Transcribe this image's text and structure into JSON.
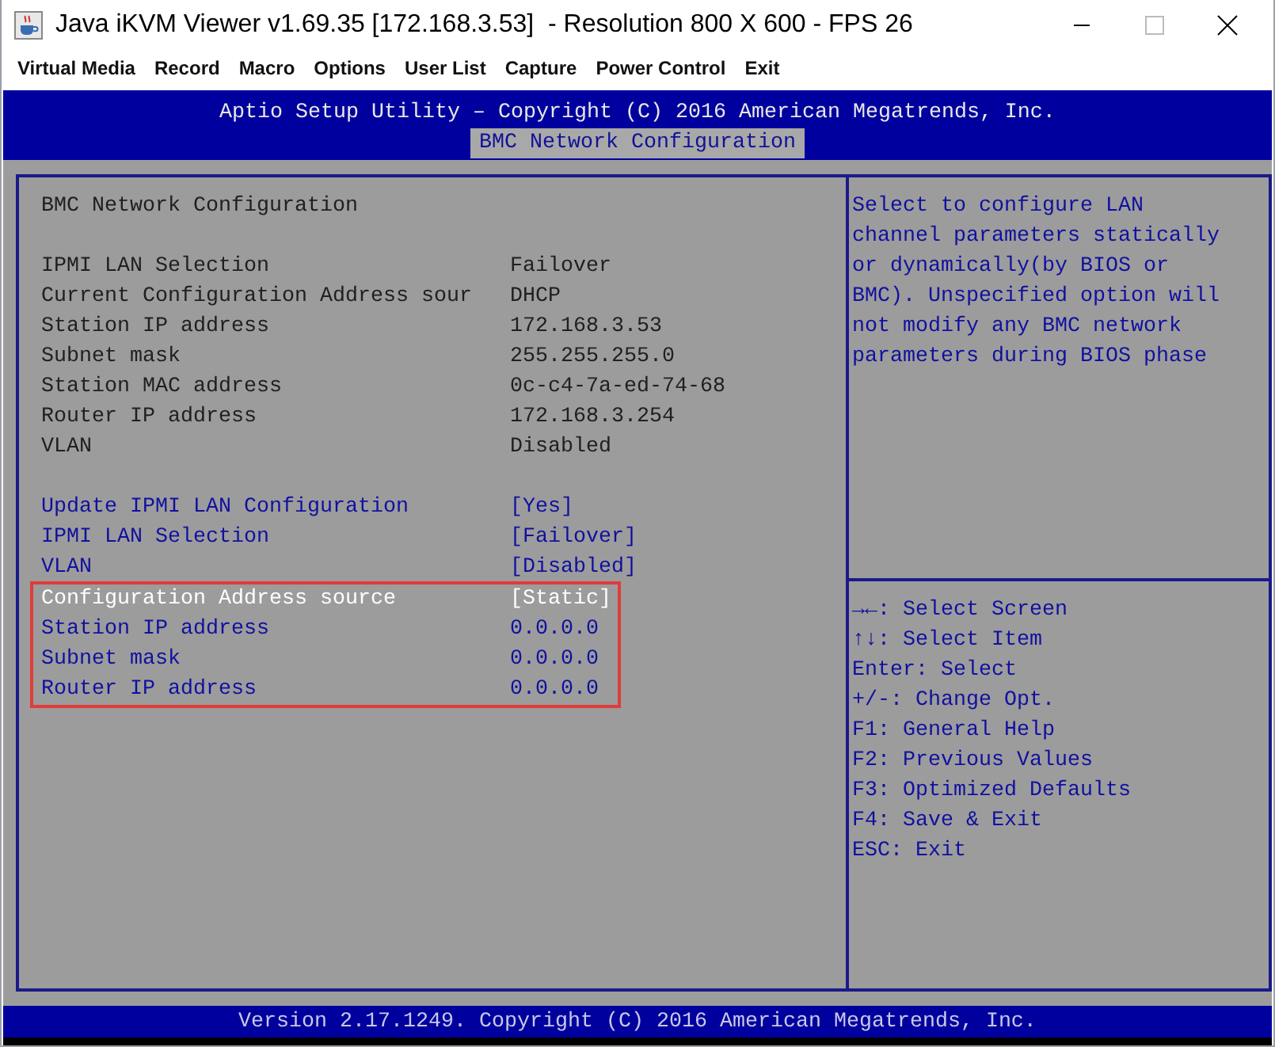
{
  "window": {
    "title": "Java iKVM Viewer v1.69.35 [172.168.3.53]  - Resolution 800 X 600 - FPS 26"
  },
  "menu": [
    "Virtual Media",
    "Record",
    "Macro",
    "Options",
    "User List",
    "Capture",
    "Power Control",
    "Exit"
  ],
  "bios": {
    "header": "Aptio Setup Utility – Copyright (C) 2016 American Megatrends, Inc.",
    "tabs": [
      {
        "label": "BMC Network Configuration",
        "selected": true
      }
    ],
    "section_title": "BMC Network Configuration",
    "info_rows": [
      {
        "label": "IPMI LAN Selection",
        "value": "Failover"
      },
      {
        "label": "Current Configuration Address sour",
        "value": "DHCP"
      },
      {
        "label": "Station IP address",
        "value": "172.168.3.53"
      },
      {
        "label": "Subnet mask",
        "value": "255.255.255.0"
      },
      {
        "label": "Station MAC address",
        "value": "0c-c4-7a-ed-74-68"
      },
      {
        "label": "Router IP address",
        "value": "172.168.3.254"
      },
      {
        "label": "VLAN",
        "value": "Disabled"
      }
    ],
    "settings": [
      {
        "label": "Update IPMI LAN Configuration",
        "value": "[Yes]",
        "selected": false
      },
      {
        "label": "IPMI LAN Selection",
        "value": "[Failover]",
        "selected": false
      },
      {
        "label": "VLAN",
        "value": "[Disabled]",
        "selected": false
      }
    ],
    "annotated_settings": [
      {
        "label": "Configuration Address source",
        "value": "[Static]",
        "selected": true
      },
      {
        "label": "Station IP address",
        "value": "0.0.0.0",
        "selected": false
      },
      {
        "label": "Subnet mask",
        "value": "0.0.0.0",
        "selected": false
      },
      {
        "label": "Router IP address",
        "value": "0.0.0.0",
        "selected": false
      }
    ],
    "help_text": "Select to configure LAN channel parameters statically or dynamically(by BIOS or BMC). Unspecified option will not modify any BMC network parameters during BIOS phase",
    "keys": [
      "→←: Select Screen",
      "↑↓: Select Item",
      "Enter: Select",
      "+/-: Change Opt.",
      "F1: General Help",
      "F2: Previous Values",
      "F3: Optimized Defaults",
      "F4: Save & Exit",
      "ESC: Exit"
    ],
    "footer": "Version 2.17.1249. Copyright (C) 2016 American Megatrends, Inc."
  }
}
